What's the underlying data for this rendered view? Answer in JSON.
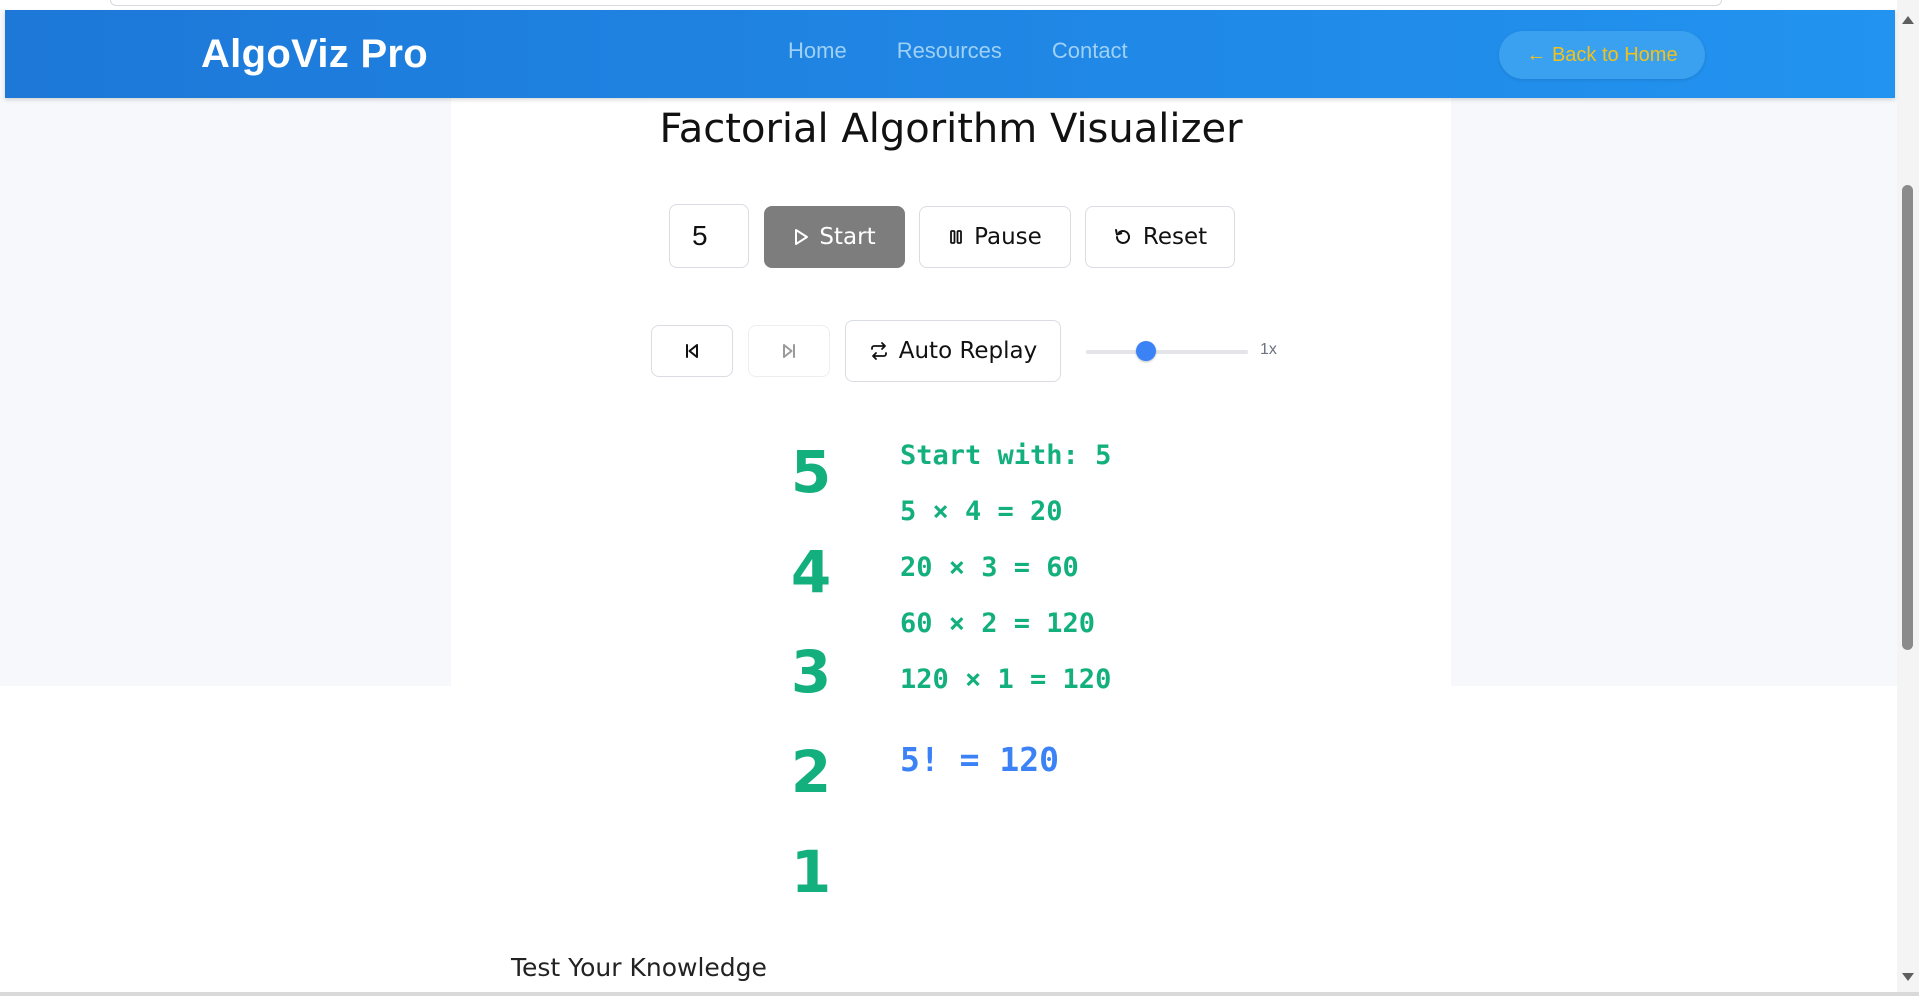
{
  "header": {
    "brand": "AlgoViz Pro",
    "nav": [
      "Home",
      "Resources",
      "Contact"
    ],
    "back_button": "← Back to Home"
  },
  "main": {
    "title": "Factorial Algorithm Visualizer",
    "input_value": "5",
    "controls": {
      "start": "Start",
      "pause": "Pause",
      "reset": "Reset",
      "auto_replay": "Auto Replay",
      "speed_label": "1x",
      "speed_level": 0.37
    },
    "numbers": [
      "5",
      "4",
      "3",
      "2",
      "1"
    ],
    "steps": [
      "Start with: 5",
      "5 × 4 = 20",
      "20 × 3 = 60",
      "60 × 2 = 120",
      "120 × 1 = 120"
    ],
    "result": "5! = 120",
    "quiz_title": "Test Your Knowledge"
  },
  "colors": {
    "header_start": "#1d78d8",
    "header_end": "#2293f0",
    "brand_text": "#ffffff",
    "nav_text": "#9fd0f5",
    "back_button_text": "#f2c21b",
    "start_button_bg": "#7d7d7d",
    "accent_green": "#13b07e",
    "accent_blue": "#3b82f6"
  },
  "icons": {
    "start": "play-icon",
    "pause": "pause-icon",
    "reset": "reset-icon",
    "prev": "skip-back-icon",
    "next": "skip-forward-icon",
    "auto_replay": "repeat-icon"
  }
}
